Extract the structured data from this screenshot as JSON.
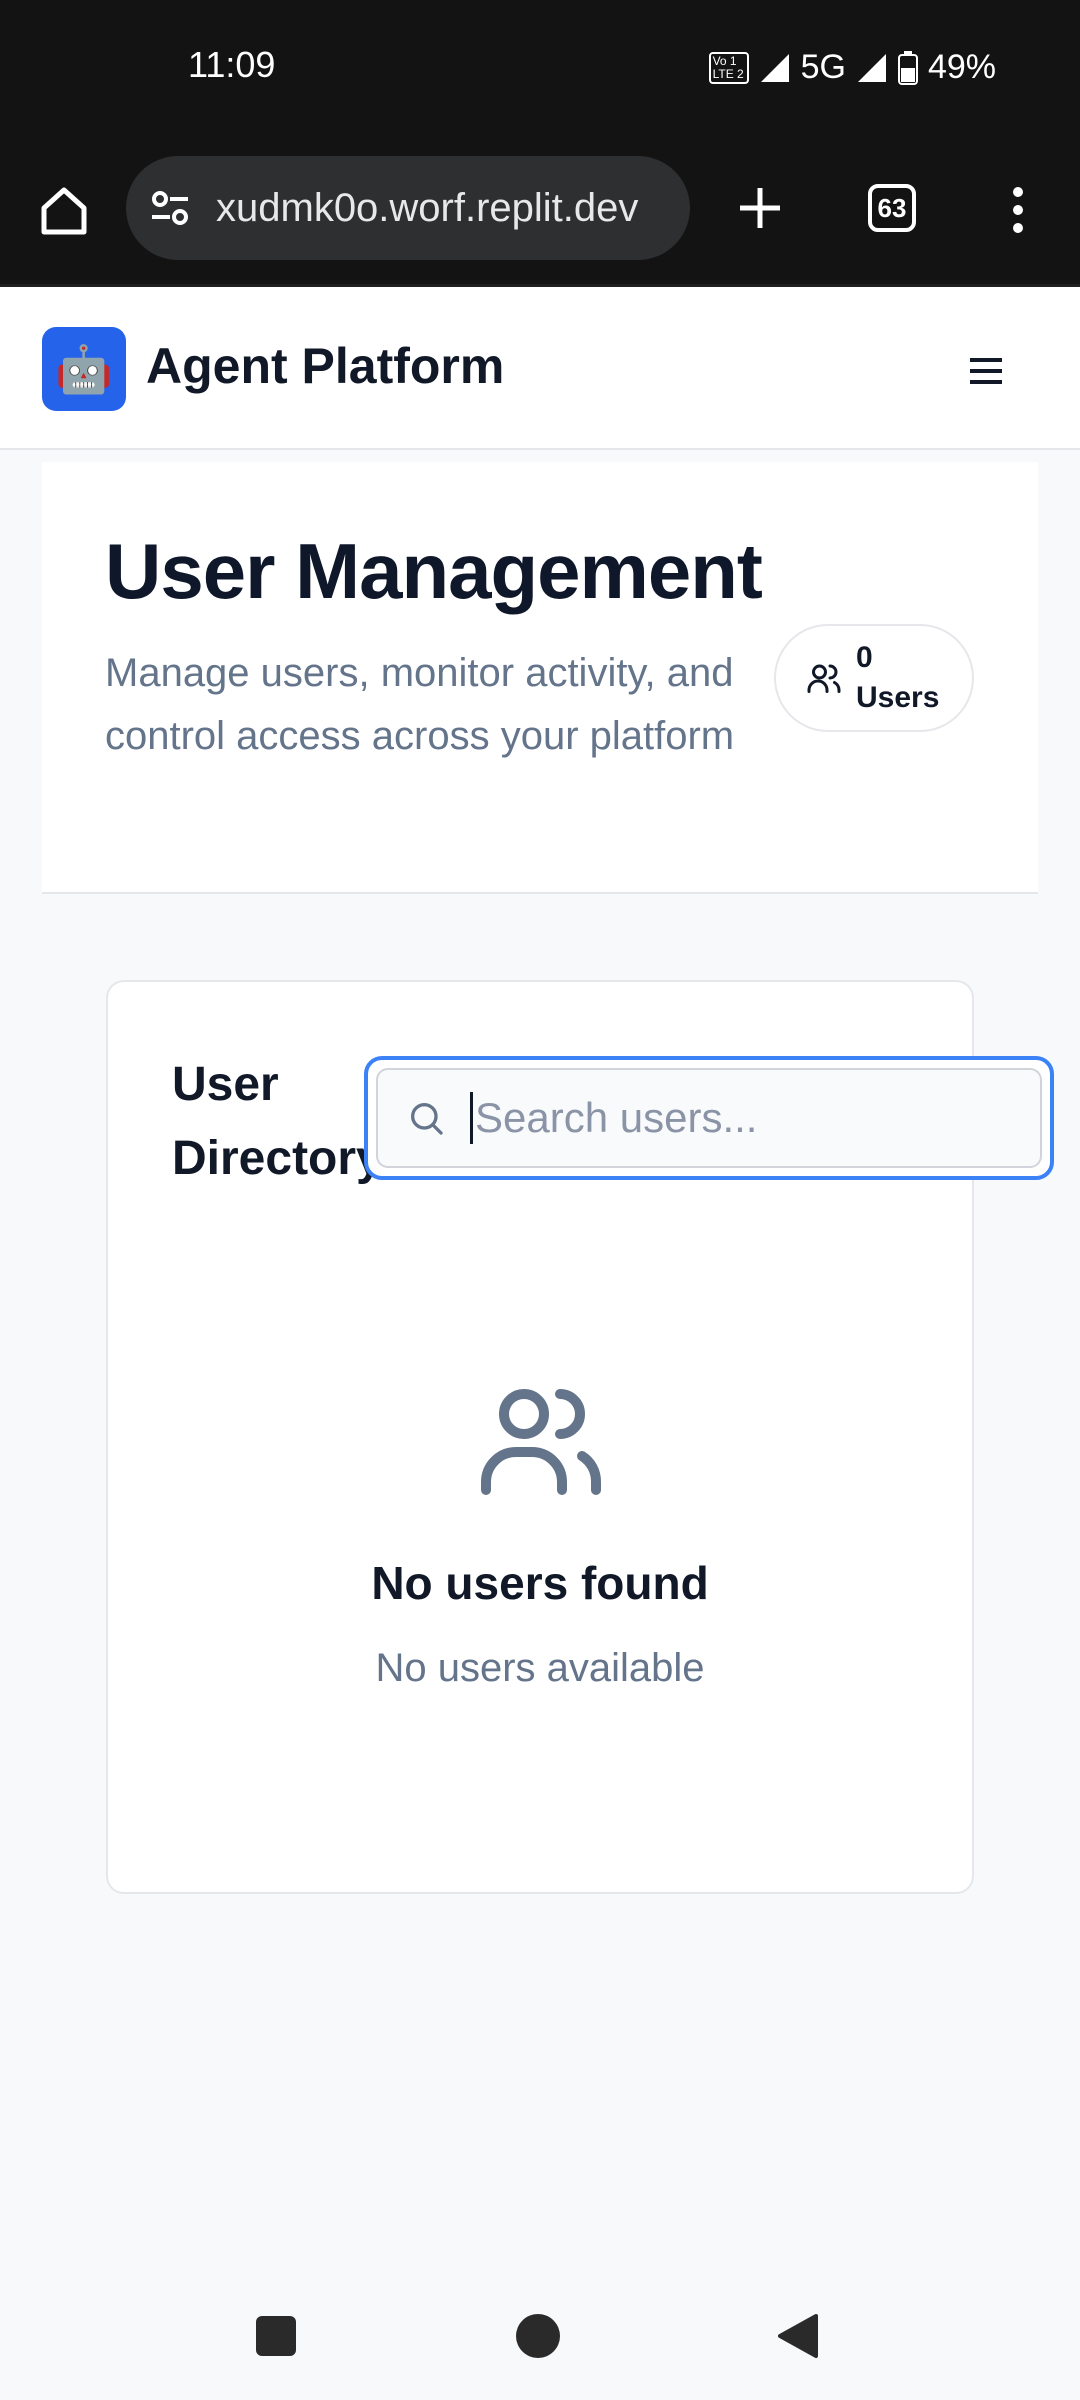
{
  "status_bar": {
    "time": "11:09",
    "volte_top": "Vo 1",
    "volte_bottom": "LTE 2",
    "network": "5G",
    "battery": "49%"
  },
  "browser": {
    "url": "xudmk0o.worf.replit.dev",
    "tab_count": "63",
    "icons": [
      "home-icon",
      "site-settings-icon",
      "new-tab-icon",
      "tabs-icon",
      "more-menu-icon"
    ]
  },
  "app": {
    "title": "Agent Platform",
    "logo_emoji": "🤖",
    "brand_color": "#2563eb"
  },
  "hero": {
    "title": "User Management",
    "subtitle": "Manage users, monitor activity, and control access across your platform",
    "users_count": "0",
    "users_label": "Users"
  },
  "directory": {
    "title": "User Directory",
    "search_placeholder": "Search users...",
    "search_value": "",
    "empty_title": "No users found",
    "empty_subtitle": "No users available"
  },
  "accent_color": "#3b82f6"
}
